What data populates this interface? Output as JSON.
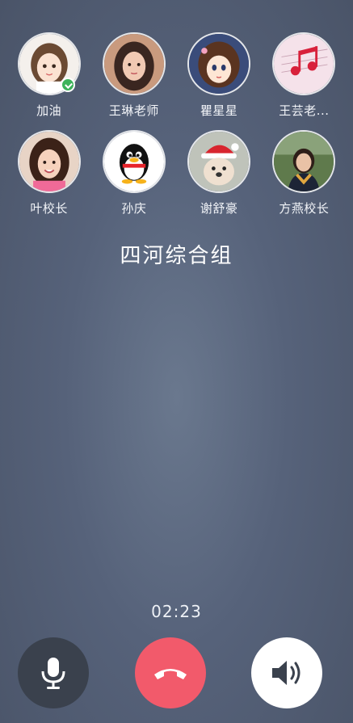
{
  "members_row1": [
    {
      "name": "加油",
      "icon": "avatar-cartoon-girl"
    },
    {
      "name": "王琳老师",
      "icon": "avatar-woman"
    },
    {
      "name": "瞿星星",
      "icon": "avatar-anime-girl"
    },
    {
      "name": "王芸老...",
      "icon": "avatar-music-notes"
    }
  ],
  "members_row2": [
    {
      "name": "叶校长",
      "icon": "avatar-woman-smiling"
    },
    {
      "name": "孙庆",
      "icon": "avatar-qq-penguin"
    },
    {
      "name": "谢舒豪",
      "icon": "avatar-santa-dog"
    },
    {
      "name": "方燕校长",
      "icon": "avatar-woman-outdoor"
    }
  ],
  "group_name": "四河综合组",
  "call_timer": "02:23",
  "controls": {
    "mute": "microphone-icon",
    "hangup": "hangup-phone-icon",
    "speaker": "speaker-icon"
  },
  "colors": {
    "hangup": "#f25a6b",
    "mic_bg": "#3a414d",
    "speaker_bg": "#ffffff",
    "online_badge": "#3db35a"
  }
}
